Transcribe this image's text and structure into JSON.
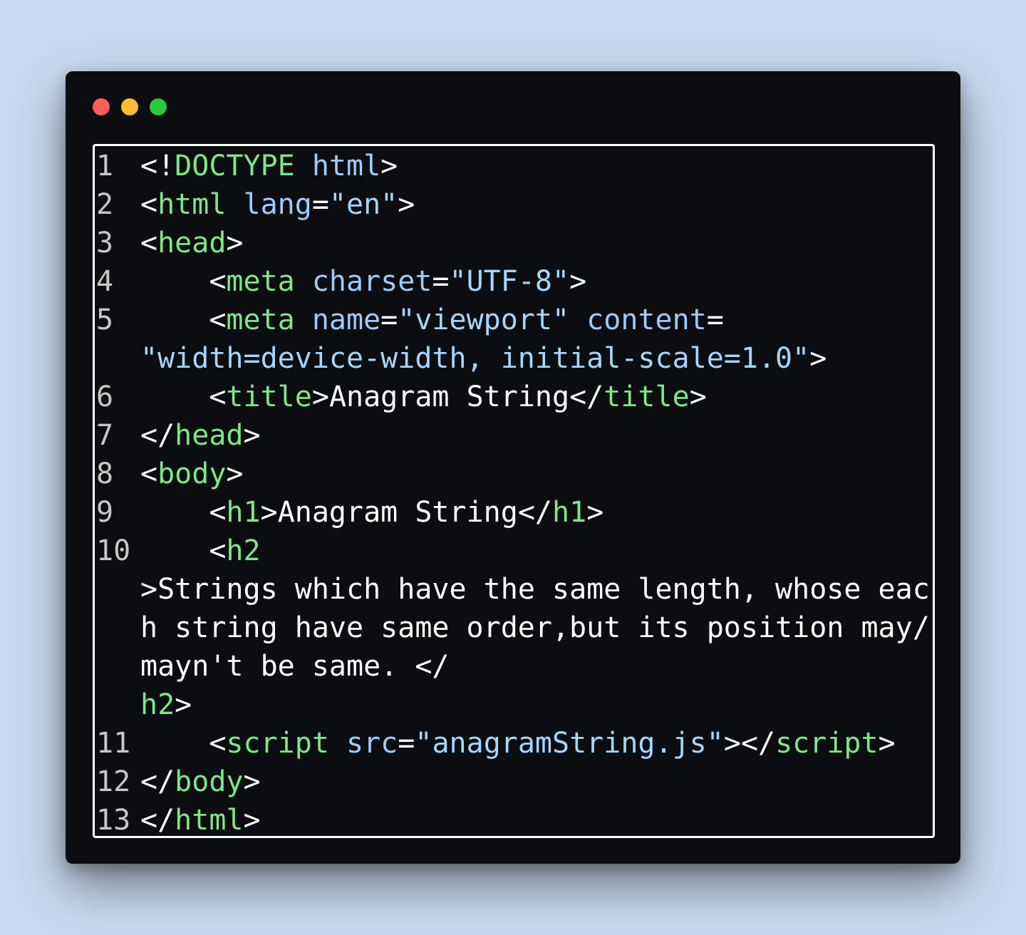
{
  "window": {
    "traffic_lights": [
      {
        "name": "close",
        "color": "#ff5f57"
      },
      {
        "name": "minimize",
        "color": "#febc2e"
      },
      {
        "name": "maximize",
        "color": "#28c840"
      }
    ]
  },
  "colors": {
    "tag": "#7ee787",
    "attr": "#9ecbff",
    "string": "#a5d6ff",
    "text": "#ffffff",
    "line_number": "#c7c7c7",
    "background": "#0b0d10"
  },
  "code": {
    "rows": [
      {
        "ln": "1",
        "segments": [
          [
            "punct",
            "<!"
          ],
          [
            "tag",
            "DOCTYPE"
          ],
          [
            "plain",
            " "
          ],
          [
            "attr",
            "html"
          ],
          [
            "punct",
            ">"
          ]
        ]
      },
      {
        "ln": "2",
        "segments": [
          [
            "punct",
            "<"
          ],
          [
            "tag",
            "html"
          ],
          [
            "plain",
            " "
          ],
          [
            "attr",
            "lang"
          ],
          [
            "punct",
            "="
          ],
          [
            "str",
            "\"en\""
          ],
          [
            "punct",
            ">"
          ]
        ]
      },
      {
        "ln": "3",
        "segments": [
          [
            "punct",
            "<"
          ],
          [
            "tag",
            "head"
          ],
          [
            "punct",
            ">"
          ]
        ]
      },
      {
        "ln": "4",
        "segments": [
          [
            "plain",
            "    "
          ],
          [
            "punct",
            "<"
          ],
          [
            "tag",
            "meta"
          ],
          [
            "plain",
            " "
          ],
          [
            "attr",
            "charset"
          ],
          [
            "punct",
            "="
          ],
          [
            "str",
            "\"UTF-8\""
          ],
          [
            "punct",
            ">"
          ]
        ]
      },
      {
        "ln": "5",
        "segments": [
          [
            "plain",
            "    "
          ],
          [
            "punct",
            "<"
          ],
          [
            "tag",
            "meta"
          ],
          [
            "plain",
            " "
          ],
          [
            "attr",
            "name"
          ],
          [
            "punct",
            "="
          ],
          [
            "str",
            "\"viewport\""
          ],
          [
            "plain",
            " "
          ],
          [
            "attr",
            "content"
          ],
          [
            "punct",
            "="
          ]
        ]
      },
      {
        "ln": "",
        "segments": [
          [
            "str",
            "\"width=device-width, initial-scale=1.0\""
          ],
          [
            "punct",
            ">"
          ]
        ]
      },
      {
        "ln": "6",
        "segments": [
          [
            "plain",
            "    "
          ],
          [
            "punct",
            "<"
          ],
          [
            "tag",
            "title"
          ],
          [
            "punct",
            ">"
          ],
          [
            "plain",
            "Anagram String"
          ],
          [
            "punct",
            "</"
          ],
          [
            "tag",
            "title"
          ],
          [
            "punct",
            ">"
          ]
        ]
      },
      {
        "ln": "7",
        "segments": [
          [
            "punct",
            "</"
          ],
          [
            "tag",
            "head"
          ],
          [
            "punct",
            ">"
          ]
        ]
      },
      {
        "ln": "8",
        "segments": [
          [
            "punct",
            "<"
          ],
          [
            "tag",
            "body"
          ],
          [
            "punct",
            ">"
          ]
        ]
      },
      {
        "ln": "9",
        "segments": [
          [
            "plain",
            "    "
          ],
          [
            "punct",
            "<"
          ],
          [
            "tag",
            "h1"
          ],
          [
            "punct",
            ">"
          ],
          [
            "plain",
            "Anagram String"
          ],
          [
            "punct",
            "</"
          ],
          [
            "tag",
            "h1"
          ],
          [
            "punct",
            ">"
          ]
        ]
      },
      {
        "ln": "10",
        "segments": [
          [
            "plain",
            "    "
          ],
          [
            "punct",
            "<"
          ],
          [
            "tag",
            "h2"
          ]
        ]
      },
      {
        "ln": "",
        "segments": [
          [
            "punct",
            ">"
          ],
          [
            "plain",
            "Strings which have the same length, whose eac"
          ]
        ]
      },
      {
        "ln": "",
        "segments": [
          [
            "plain",
            "h string have same order,but its position may/"
          ]
        ]
      },
      {
        "ln": "",
        "segments": [
          [
            "plain",
            "mayn't be same. "
          ],
          [
            "punct",
            "</"
          ]
        ]
      },
      {
        "ln": "",
        "segments": [
          [
            "tag",
            "h2"
          ],
          [
            "punct",
            ">"
          ]
        ]
      },
      {
        "ln": "11",
        "segments": [
          [
            "plain",
            "    "
          ],
          [
            "punct",
            "<"
          ],
          [
            "tag",
            "script"
          ],
          [
            "plain",
            " "
          ],
          [
            "attr",
            "src"
          ],
          [
            "punct",
            "="
          ],
          [
            "str",
            "\"anagramString.js\""
          ],
          [
            "punct",
            "></"
          ],
          [
            "tag",
            "script"
          ],
          [
            "punct",
            ">"
          ]
        ]
      },
      {
        "ln": "12",
        "segments": [
          [
            "punct",
            "</"
          ],
          [
            "tag",
            "body"
          ],
          [
            "punct",
            ">"
          ]
        ]
      },
      {
        "ln": "13",
        "segments": [
          [
            "punct",
            "</"
          ],
          [
            "tag",
            "html"
          ],
          [
            "punct",
            ">"
          ]
        ]
      }
    ]
  }
}
